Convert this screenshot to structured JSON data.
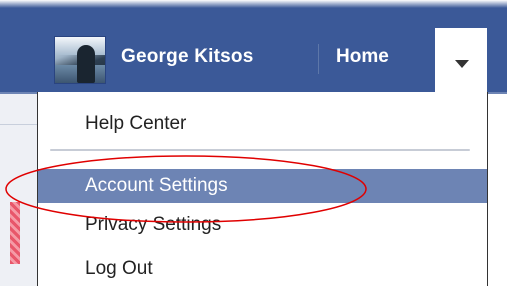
{
  "header": {
    "username": "George Kitsos",
    "home_label": "Home",
    "avatar_icon": "user-avatar",
    "dropdown_icon": "caret-down-icon",
    "bar_color": "#3b5998"
  },
  "menu": {
    "items": [
      {
        "label": "Help Center",
        "selected": false
      },
      {
        "label": "Account Settings",
        "selected": true
      },
      {
        "label": "Privacy Settings",
        "selected": false
      },
      {
        "label": "Log Out",
        "selected": false
      }
    ],
    "selected_color": "#6d84b4"
  },
  "annotation": {
    "shape": "ellipse",
    "color": "#e00000",
    "target": "Account Settings"
  }
}
